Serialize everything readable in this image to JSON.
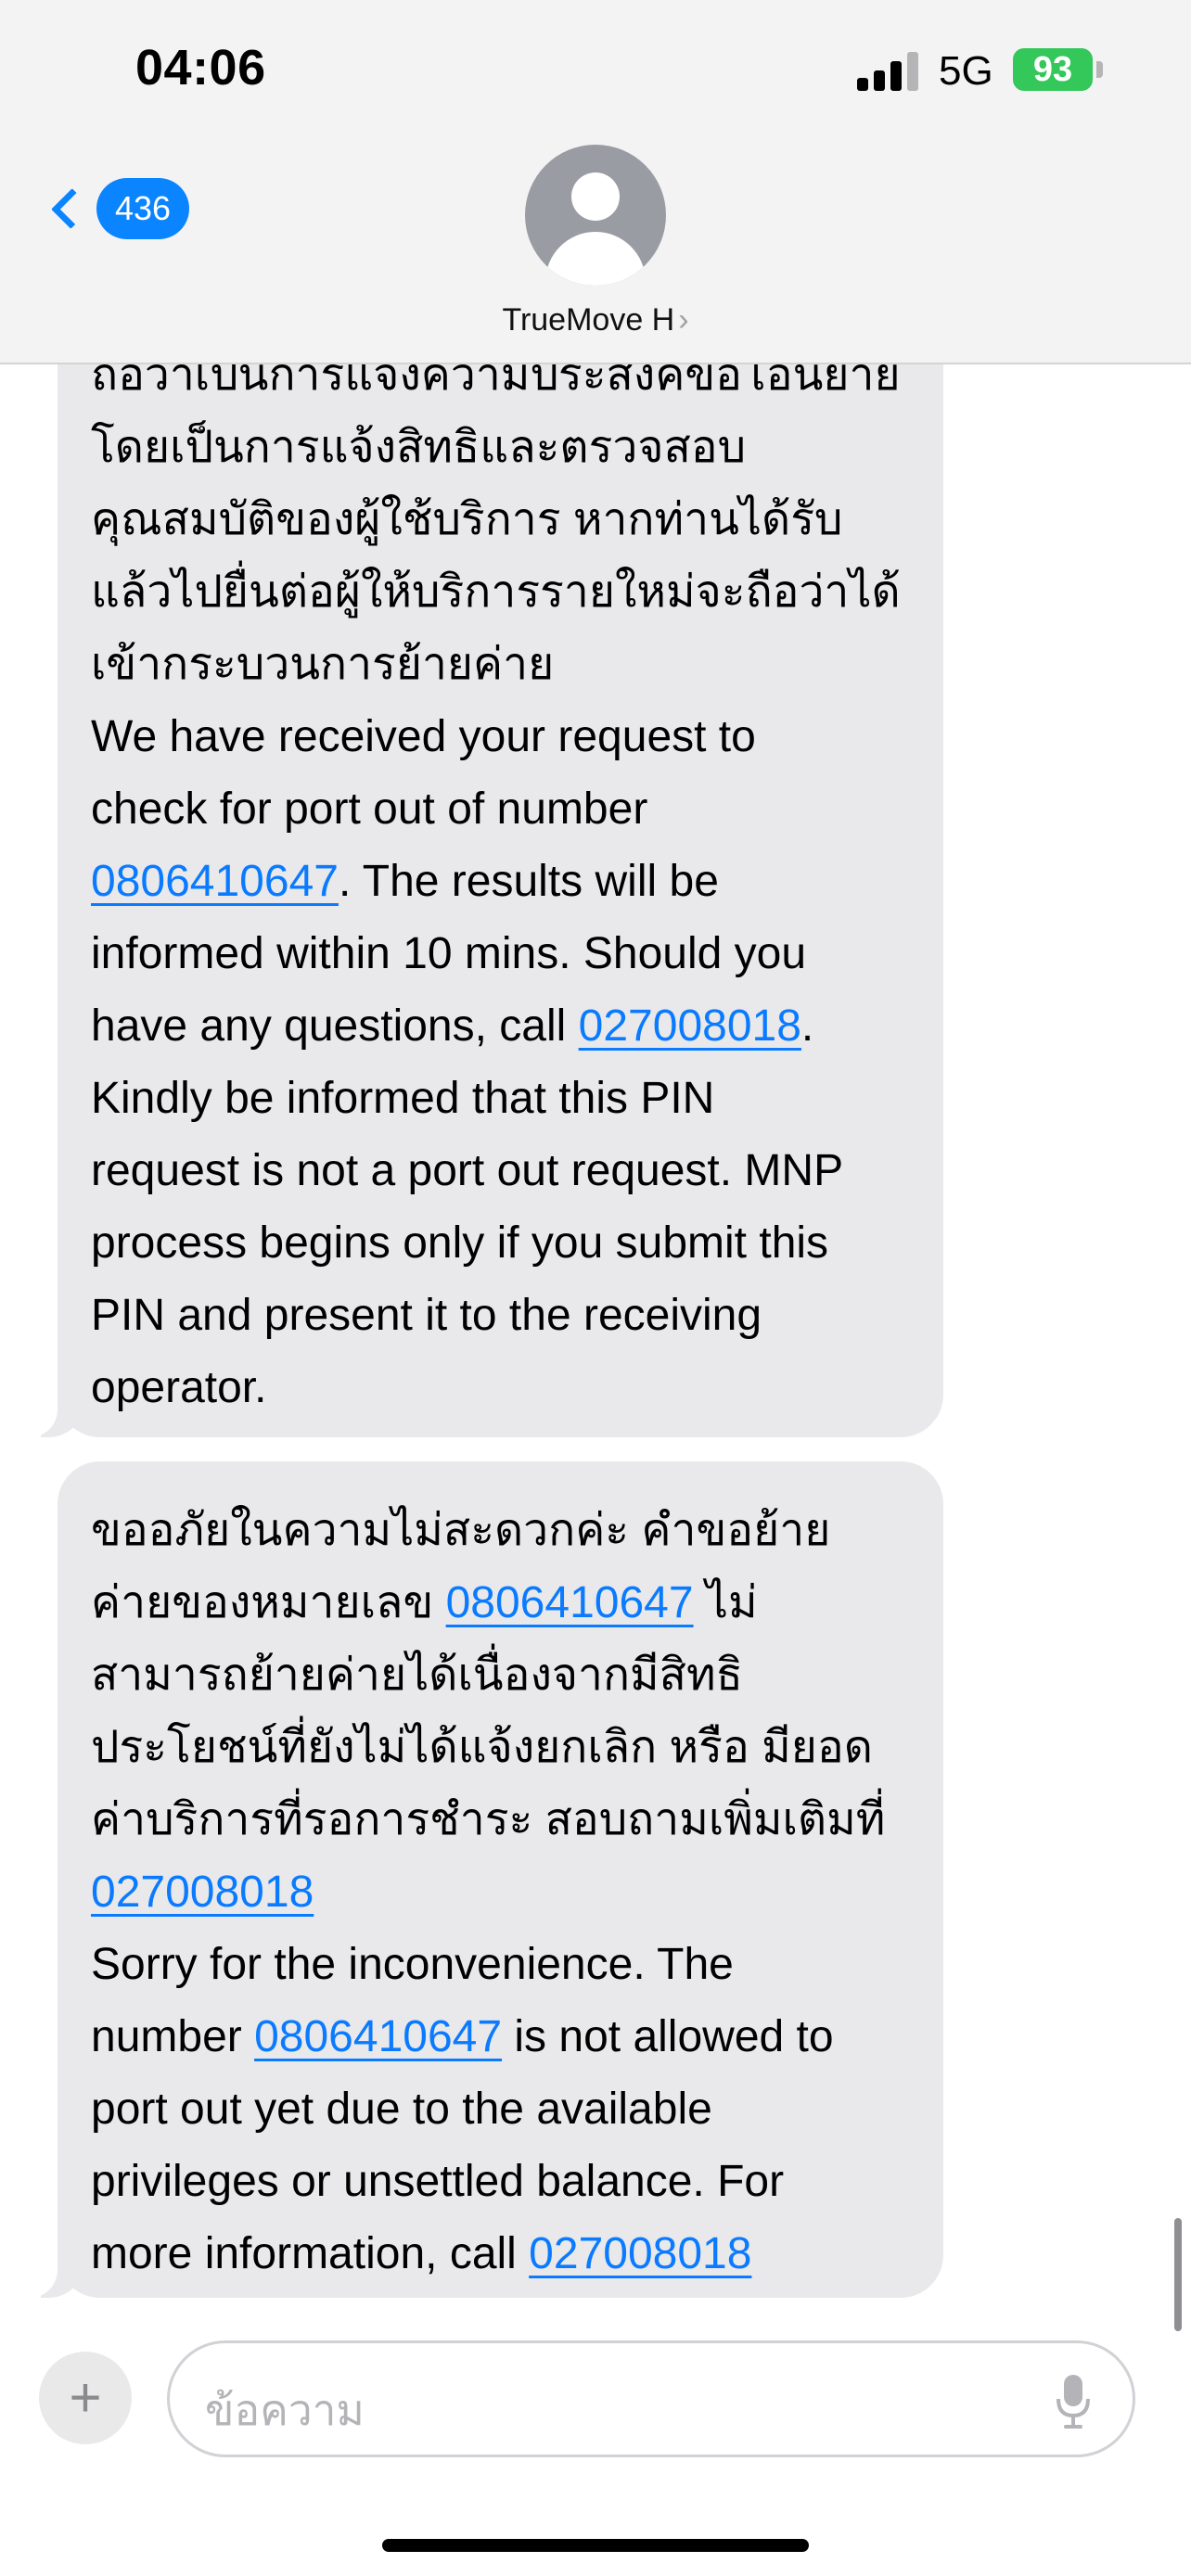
{
  "status_bar": {
    "time": "04:06",
    "network": "5G",
    "battery": "93",
    "battery_color": "#34c759"
  },
  "header": {
    "back_badge_count": "436",
    "contact_name": "TrueMove H",
    "contact_chevron": "›",
    "accent_color": "#0a84ff",
    "icons": [
      "back-chevron-icon",
      "person-avatar-icon"
    ]
  },
  "messages": [
    {
      "lines": [
        [
          "ถือว่าเป็นการแจ้งความประสงค์ขอโอนย้าย"
        ],
        [
          "โดยเป็นการแจ้งสิทธิและตรวจสอบ"
        ],
        [
          "คุณสมบัติของผู้ใช้บริการ หากท่านได้รับ"
        ],
        [
          "แล้วไปยื่นต่อผู้ให้บริการรายใหม่จะถือว่าได้"
        ],
        [
          "เข้ากระบวนการย้ายค่าย"
        ],
        [
          "We have received your request to"
        ],
        [
          "check for port out of number"
        ],
        [
          "0806410647",
          ". The results will be"
        ],
        [
          "informed within 10 mins. Should you"
        ],
        [
          "have any questions, call ",
          "027008018",
          "."
        ],
        [
          "Kindly be informed that this PIN"
        ],
        [
          "request is not a port out request. MNP"
        ],
        [
          "process begins only if you submit this"
        ],
        [
          "PIN and present it to the receiving"
        ],
        [
          "operator."
        ]
      ],
      "links": [
        "0806410647",
        "027008018"
      ]
    },
    {
      "lines": [
        [
          "ขออภัยในความไม่สะดวกค่ะ คำขอย้าย"
        ],
        [
          "ค่ายของหมายเลข ",
          "0806410647",
          " ไม่"
        ],
        [
          "สามารถย้ายค่ายได้เนื่องจากมีสิทธิ"
        ],
        [
          "ประโยชน์ที่ยังไม่ได้แจ้งยกเลิก หรือ มียอด"
        ],
        [
          "ค่าบริการที่รอการชำระ สอบถามเพิ่มเติมที่"
        ],
        [
          "027008018"
        ],
        [
          "Sorry for the inconvenience. The"
        ],
        [
          "number ",
          "0806410647",
          " is not allowed to"
        ],
        [
          "port out yet due to the available"
        ],
        [
          "privileges or unsettled balance. For"
        ],
        [
          "more information, call ",
          "027008018"
        ]
      ],
      "links": [
        "0806410647",
        "027008018"
      ]
    }
  ],
  "composer": {
    "placeholder": "ข้อความ",
    "plus_label": "+",
    "icons": [
      "plus-icon",
      "microphone-icon"
    ]
  }
}
